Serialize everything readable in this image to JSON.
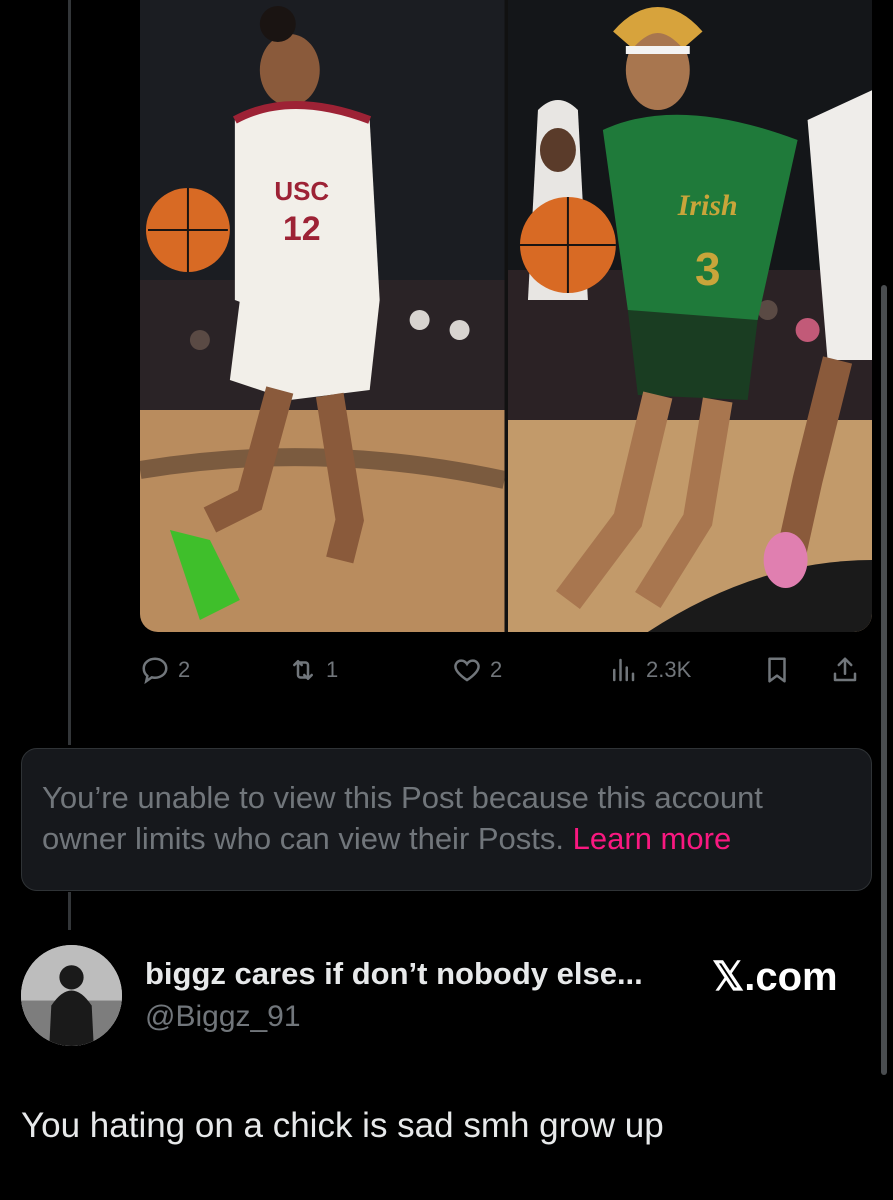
{
  "post": {
    "photos": [
      {
        "jersey_text": "USC",
        "jersey_number": "12"
      },
      {
        "jersey_text": "Irish",
        "jersey_number": "3"
      }
    ],
    "actions": {
      "replies": "2",
      "reposts": "1",
      "likes": "2",
      "views": "2.3K"
    }
  },
  "notice": {
    "text": "You’re unable to view this Post because this account owner limits who can view their Posts.",
    "link": "Learn more"
  },
  "reply": {
    "display_name": "biggz cares if don’t nobody else...",
    "handle": "@Biggz_91",
    "site_mark": "𝕏.com",
    "text": "You hating on a chick is sad smh grow up"
  },
  "colors": {
    "background": "#000000",
    "muted": "#71767b",
    "link": "#f91880",
    "card": "#16181c"
  }
}
